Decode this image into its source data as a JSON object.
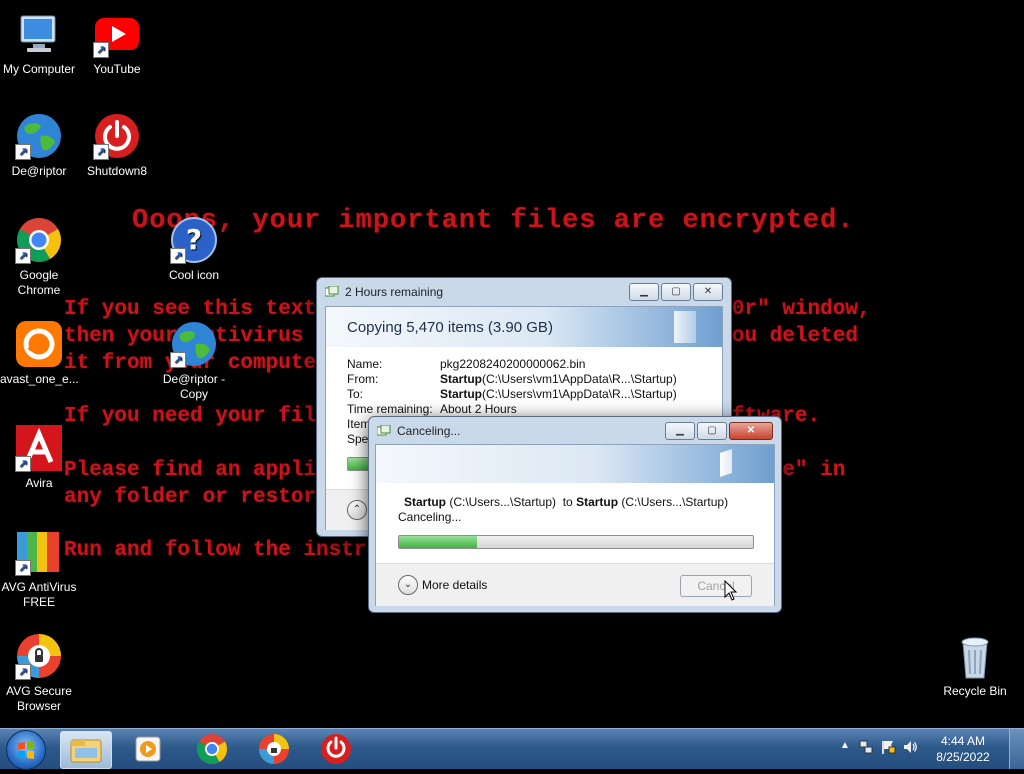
{
  "desktop": {
    "ransom": {
      "title": "Ooops, your important files are encrypted.",
      "lines": [
        "If you see this text, but don't see the \"Wana Decrypt0r\" window,",
        "then your antivirus removed the decrypt software or you deleted",
        "it from your computer.",
        "If you need your files you have to run the decrypt software.",
        "Please find an application file named \"@WanaDecryptor@.exe\" in",
        "any folder or restore from the antivirus quarantine.",
        "Run and follow the instructions!"
      ]
    },
    "icons": [
      {
        "label": "My Computer",
        "icon": "computer-icon"
      },
      {
        "label": "YouTube",
        "icon": "youtube-icon"
      },
      {
        "label": "De@riptor",
        "icon": "globe-icon"
      },
      {
        "label": "Shutdown8",
        "icon": "power-icon"
      },
      {
        "label": "Google Chrome",
        "icon": "chrome-icon"
      },
      {
        "label": "Cool icon",
        "icon": "help-icon"
      },
      {
        "label": "avast_one_e...",
        "icon": "avast-icon"
      },
      {
        "label": "De@riptor - Copy",
        "icon": "globe-icon"
      },
      {
        "label": "Avira",
        "icon": "avira-icon"
      },
      {
        "label": "AVG AntiVirus FREE",
        "icon": "avg-icon"
      },
      {
        "label": "AVG Secure Browser",
        "icon": "avg-browser-icon"
      },
      {
        "label": "Recycle Bin",
        "icon": "recycle-bin-icon"
      }
    ]
  },
  "copy_dialog": {
    "title": "2 Hours remaining",
    "heading": "Copying 5,470 items (3.90 GB)",
    "fields": [
      {
        "key": "Name:",
        "bold": "",
        "value": "pkg2208240200000062.bin"
      },
      {
        "key": "From:",
        "bold": "Startup",
        "value": " (C:\\Users\\vm1\\AppData\\R...\\Startup)"
      },
      {
        "key": "To:",
        "bold": "Startup",
        "value": " (C:\\Users\\vm1\\AppData\\R...\\Startup)"
      },
      {
        "key": "Time remaining:",
        "bold": "",
        "value": "About 2 Hours"
      },
      {
        "key": "Item",
        "bold": "",
        "value": ""
      },
      {
        "key": "Spee",
        "bold": "",
        "value": ""
      }
    ],
    "progress": 0.25
  },
  "cancel_dialog": {
    "title": "Canceling...",
    "src_name": "Startup",
    "src_path": " (C:\\Users...\\Startup)",
    "to_word": "to",
    "dst_name": "Startup",
    "dst_path": " (C:\\Users...\\Startup)",
    "status": "Canceling...",
    "progress": 0.22,
    "more_details": "More details",
    "cancel_label": "Cancel"
  },
  "taskbar": {
    "time": "4:44 AM",
    "date": "8/25/2022",
    "pinned": [
      "explorer-icon",
      "media-player-icon",
      "chrome-icon",
      "avast-secure-browser-icon",
      "shutdown-icon"
    ]
  },
  "colors": {
    "ransom_text": "#c8141c",
    "taskbar": "#2d5a8b",
    "progress_green": "#3fb43e"
  }
}
